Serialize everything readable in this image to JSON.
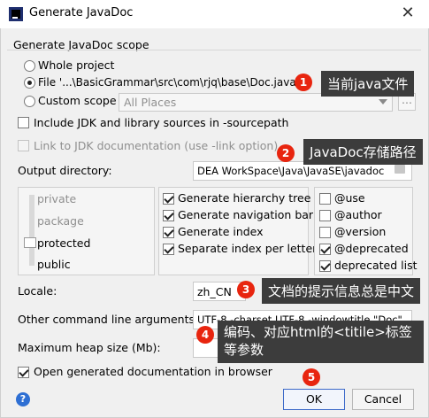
{
  "window": {
    "title": "Generate JavaDoc",
    "close_symbol": "✕"
  },
  "scope": {
    "section_title": "Generate JavaDoc scope",
    "whole_project": "Whole project",
    "file_label": "File '...\\BasicGrammar\\src\\com\\rjq\\base\\Doc.java'",
    "custom_scope": "Custom scope",
    "custom_scope_value": "All Places",
    "ellipsis_button": "...",
    "selected": "file"
  },
  "options": {
    "include_jdk": "Include JDK and library sources in -sourcepath",
    "link_jdk": "Link to JDK documentation (use -link option)"
  },
  "output": {
    "label": "Output directory:",
    "value": "DEA WorkSpace\\Java\\JavaSE\\javadoc"
  },
  "visibility": {
    "levels": [
      "private",
      "package",
      "protected",
      "public"
    ],
    "selected": "protected"
  },
  "generate": {
    "items": [
      {
        "label": "Generate hierarchy tree",
        "checked": true
      },
      {
        "label": "Generate navigation bar",
        "checked": true
      },
      {
        "label": "Generate index",
        "checked": true
      },
      {
        "label": "Separate index per letter",
        "checked": true
      }
    ]
  },
  "tags": {
    "items": [
      {
        "label": "@use",
        "checked": false
      },
      {
        "label": "@author",
        "checked": false
      },
      {
        "label": "@version",
        "checked": false
      },
      {
        "label": "@deprecated",
        "checked": true
      },
      {
        "label": "deprecated list",
        "checked": true
      }
    ]
  },
  "locale": {
    "label": "Locale:",
    "value": "zh_CN"
  },
  "other_args": {
    "label": "Other command line arguments:",
    "value": "UTF-8 -charset UTF-8 -windowtitle \"Doc\""
  },
  "heap": {
    "label": "Maximum heap size (Mb):",
    "value": ""
  },
  "open_browser": {
    "label": "Open generated documentation in browser",
    "checked": true
  },
  "buttons": {
    "ok": "OK",
    "cancel": "Cancel",
    "help": "?"
  },
  "annotations": [
    {
      "number": "1",
      "text": "当前java文件"
    },
    {
      "number": "2",
      "text": "JavaDoc存储路径"
    },
    {
      "number": "3",
      "text": "文档的提示信息总是中文"
    },
    {
      "number": "4",
      "text": "编码、对应html的<titile>标签\n等参数"
    },
    {
      "number": "5",
      "text": ""
    }
  ],
  "colors": {
    "badge": "#e8250f",
    "tooltip": "#3c3c3c",
    "accent": "#2e6fd3"
  }
}
